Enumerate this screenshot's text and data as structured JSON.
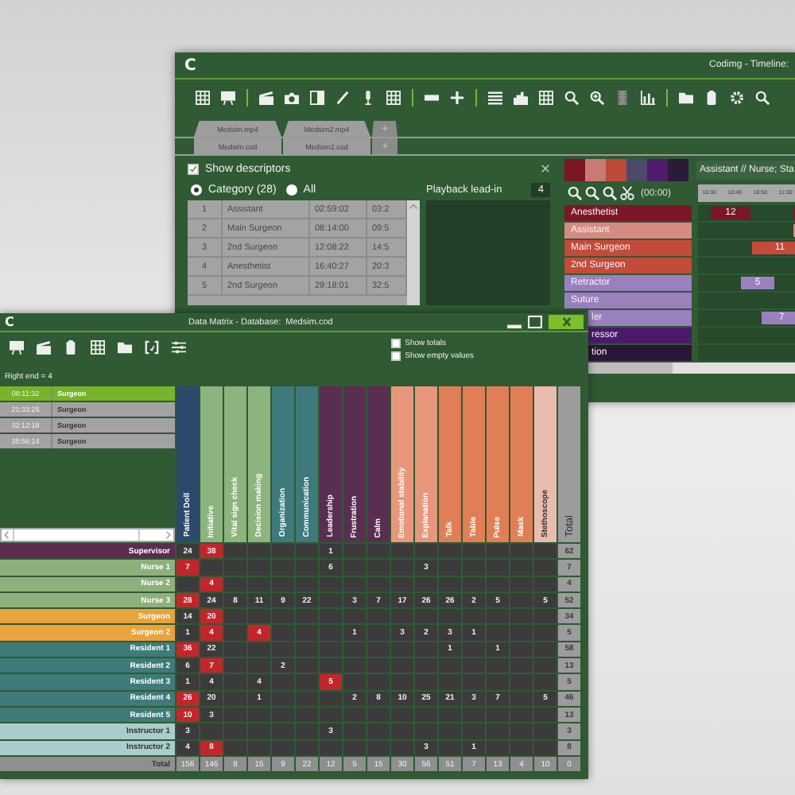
{
  "timeline_window": {
    "logo": "C",
    "title": "Codimg - Timeline:",
    "media_tabs": [
      {
        "label": "Medsim.mp4",
        "kind": "file"
      },
      {
        "label": "Medsim2.mp4",
        "kind": "file"
      },
      {
        "label": "+",
        "kind": "add"
      }
    ],
    "file_tabs": [
      {
        "label": "Medsim.cod",
        "kind": "file"
      },
      {
        "label": "Medsim2.cod",
        "kind": "file"
      },
      {
        "label": "+",
        "kind": "add"
      }
    ],
    "show_descriptors": {
      "label": "Show descriptors",
      "checked": true
    },
    "filters": [
      {
        "label": "Category (28)",
        "selected": true
      },
      {
        "label": "All",
        "selected": false
      }
    ],
    "descriptors": [
      {
        "number": "1",
        "name": "Assistant",
        "start": "02:59:02",
        "end": "03:2"
      },
      {
        "number": "2",
        "name": "Main Surgeon",
        "start": "08:14:00",
        "end": "09:5"
      },
      {
        "number": "3",
        "name": "2nd Surgeon",
        "start": "12:08:22",
        "end": "14:5"
      },
      {
        "number": "4",
        "name": "Anesthetist",
        "start": "16:40:27",
        "end": "20:3"
      },
      {
        "number": "5",
        "name": "2nd Surgeon",
        "start": "29:18:01",
        "end": "32:5"
      }
    ],
    "playback_lead_in": {
      "label": "Playback lead-in",
      "value": "4"
    },
    "swatches": [
      {
        "color": "#7a1626"
      },
      {
        "color": "#c97b73"
      },
      {
        "color": "#bd4a3b"
      },
      {
        "color": "#4c4a6a"
      },
      {
        "color": "#4d1d6c"
      },
      {
        "color": "#2c1a3a"
      }
    ],
    "selection": "Assistant // Nurse; Sta",
    "time_display": "(00:00)",
    "ruler": [
      "10:30",
      "10:40",
      "10:50",
      "11:00"
    ],
    "tracks": [
      {
        "label": "Anesthetist",
        "color": "#7d1628",
        "clipped": false,
        "bars": [
          {
            "kind": "bar",
            "label": "12"
          },
          {
            "kind": "bar"
          }
        ]
      },
      {
        "label": "Assistant",
        "color": "#d68a84",
        "clipped": false,
        "bars": [
          {
            "kind": "bar"
          }
        ]
      },
      {
        "label": "Main Surgeon",
        "color": "#c44a3a",
        "clipped": false,
        "bars": [
          {
            "kind": "bar",
            "label": "11"
          }
        ]
      },
      {
        "label": "2nd Surgeon",
        "color": "#c44a3a",
        "clipped": false
      },
      {
        "label": "Retractor",
        "color": "#9a80bf",
        "clipped": false,
        "bars": [
          {
            "kind": "bar",
            "label": "5"
          }
        ]
      },
      {
        "label": "Suture",
        "color": "#9a80bf",
        "clipped": false
      },
      {
        "label": "ler",
        "color": "#9a80bf",
        "clipped": true,
        "bars": [
          {
            "kind": "bar",
            "label": "7"
          }
        ]
      },
      {
        "label": "ressor",
        "color": "#4b1a6a",
        "clipped": true
      },
      {
        "label": "tion",
        "color": "#2c1636",
        "clipped": true
      }
    ]
  },
  "matrix_window": {
    "logo": "C",
    "title": "Data Matrix - Database:  Medsim.cod",
    "options": [
      {
        "label": "Show totals",
        "checked": false
      },
      {
        "label": "Show empty values",
        "checked": false
      }
    ],
    "range": "Right end = 4",
    "events": [
      {
        "time": "08:11:32",
        "role": "Surgeon",
        "selected": true
      },
      {
        "time": "21:33:25",
        "role": "Surgeon",
        "selected": false
      },
      {
        "time": "32:12:18",
        "role": "Surgeon",
        "selected": false
      },
      {
        "time": "35:56:14",
        "role": "Surgeon",
        "selected": false
      }
    ],
    "columns": [
      {
        "label": "Patient Doll",
        "color": "#2b4a6c"
      },
      {
        "label": "Initiative",
        "color": "#8db37e"
      },
      {
        "label": "Vital sign check",
        "color": "#8db37e"
      },
      {
        "label": "Decision making",
        "color": "#8db37e"
      },
      {
        "label": "Organization",
        "color": "#3e7a7c"
      },
      {
        "label": "Communication",
        "color": "#3e7a7c"
      },
      {
        "label": "Leadership",
        "color": "#5a2e50"
      },
      {
        "label": "Frustration",
        "color": "#5a2e50"
      },
      {
        "label": "Calm",
        "color": "#5a2e50"
      },
      {
        "label": "Emotional stability",
        "color": "#e8977c"
      },
      {
        "label": "Explanation",
        "color": "#e8977c"
      },
      {
        "label": "Talk",
        "color": "#e07f55"
      },
      {
        "label": "Table",
        "color": "#e07f55"
      },
      {
        "label": "Pulse",
        "color": "#e07f55"
      },
      {
        "label": "Mask",
        "color": "#e07f55"
      },
      {
        "label": "Stethoscope",
        "color": "#eabcae"
      }
    ],
    "total_column": "Total",
    "rows": [
      {
        "label": "Supervisor",
        "color": "#5b2c4f",
        "total": "62",
        "cells": [
          {
            "value": "24",
            "flagged": false
          },
          {
            "value": "38",
            "flagged": true
          },
          {
            "flagged": false
          },
          {
            "flagged": false
          },
          {
            "flagged": false
          },
          {
            "flagged": false
          },
          {
            "value": "1",
            "flagged": false
          },
          {
            "flagged": false
          },
          {
            "flagged": false
          },
          {
            "flagged": false
          },
          {
            "flagged": false
          },
          {
            "flagged": false
          },
          {
            "flagged": false
          },
          {
            "flagged": false
          },
          {
            "flagged": false
          },
          {
            "flagged": false
          }
        ]
      },
      {
        "label": "Nurse 1",
        "color": "#8fb07c",
        "total": "7",
        "cells": [
          {
            "value": "7",
            "flagged": true
          },
          {
            "flagged": false
          },
          {
            "flagged": false
          },
          {
            "flagged": false
          },
          {
            "flagged": false
          },
          {
            "flagged": false
          },
          {
            "value": "6",
            "flagged": false
          },
          {
            "flagged": false
          },
          {
            "flagged": false
          },
          {
            "flagged": false
          },
          {
            "value": "3",
            "flagged": false
          },
          {
            "flagged": false
          },
          {
            "flagged": false
          },
          {
            "flagged": false
          },
          {
            "flagged": false
          },
          {
            "flagged": false
          }
        ]
      },
      {
        "label": "Nurse 2",
        "color": "#8fb07c",
        "total": "4",
        "cells": [
          {
            "flagged": false
          },
          {
            "value": "4",
            "flagged": true
          },
          {
            "flagged": false
          },
          {
            "flagged": false
          },
          {
            "flagged": false
          },
          {
            "flagged": false
          },
          {
            "flagged": false
          },
          {
            "flagged": false
          },
          {
            "flagged": false
          },
          {
            "flagged": false
          },
          {
            "flagged": false
          },
          {
            "flagged": false
          },
          {
            "flagged": false
          },
          {
            "flagged": false
          },
          {
            "flagged": false
          },
          {
            "flagged": false
          }
        ]
      },
      {
        "label": "Nurse 3",
        "color": "#8fb07c",
        "total": "52",
        "cells": [
          {
            "value": "28",
            "flagged": true
          },
          {
            "value": "24",
            "flagged": false
          },
          {
            "value": "8",
            "flagged": false
          },
          {
            "value": "11",
            "flagged": false
          },
          {
            "value": "9",
            "flagged": false
          },
          {
            "value": "22",
            "flagged": false
          },
          {
            "flagged": false
          },
          {
            "value": "3",
            "flagged": false
          },
          {
            "value": "7",
            "flagged": false
          },
          {
            "value": "17",
            "flagged": false
          },
          {
            "value": "26",
            "flagged": false
          },
          {
            "value": "26",
            "flagged": false
          },
          {
            "value": "2",
            "flagged": false
          },
          {
            "value": "5",
            "flagged": false
          },
          {
            "flagged": false
          },
          {
            "value": "5",
            "flagged": false
          }
        ]
      },
      {
        "label": "Surgeon",
        "color": "#e8a33c",
        "total": "34",
        "cells": [
          {
            "value": "14",
            "flagged": false
          },
          {
            "value": "20",
            "flagged": true
          },
          {
            "flagged": false
          },
          {
            "flagged": false
          },
          {
            "flagged": false
          },
          {
            "flagged": false
          },
          {
            "flagged": false
          },
          {
            "flagged": false
          },
          {
            "flagged": false
          },
          {
            "flagged": false
          },
          {
            "flagged": false
          },
          {
            "flagged": false
          },
          {
            "flagged": false
          },
          {
            "flagged": false
          },
          {
            "flagged": false
          },
          {
            "flagged": false
          }
        ]
      },
      {
        "label": "Surgeon 2",
        "color": "#e8a33c",
        "total": "5",
        "cells": [
          {
            "value": "1",
            "flagged": false
          },
          {
            "value": "4",
            "flagged": true
          },
          {
            "flagged": false
          },
          {
            "value": "4",
            "flagged": true
          },
          {
            "flagged": false
          },
          {
            "flagged": false
          },
          {
            "flagged": false
          },
          {
            "value": "1",
            "flagged": false
          },
          {
            "flagged": false
          },
          {
            "value": "3",
            "flagged": false
          },
          {
            "value": "2",
            "flagged": false
          },
          {
            "value": "3",
            "flagged": false
          },
          {
            "value": "1",
            "flagged": false
          },
          {
            "flagged": false
          },
          {
            "flagged": false
          },
          {
            "flagged": false
          }
        ]
      },
      {
        "label": "Resident 1",
        "color": "#3e7b79",
        "total": "58",
        "cells": [
          {
            "value": "36",
            "flagged": true
          },
          {
            "value": "22",
            "flagged": false
          },
          {
            "flagged": false
          },
          {
            "flagged": false
          },
          {
            "flagged": false
          },
          {
            "flagged": false
          },
          {
            "flagged": false
          },
          {
            "flagged": false
          },
          {
            "flagged": false
          },
          {
            "flagged": false
          },
          {
            "flagged": false
          },
          {
            "value": "1",
            "flagged": false
          },
          {
            "flagged": false
          },
          {
            "value": "1",
            "flagged": false
          },
          {
            "flagged": false
          },
          {
            "flagged": false
          }
        ]
      },
      {
        "label": "Resident 2",
        "color": "#3e7b79",
        "total": "13",
        "cells": [
          {
            "value": "6",
            "flagged": false
          },
          {
            "value": "7",
            "flagged": true
          },
          {
            "flagged": false
          },
          {
            "flagged": false
          },
          {
            "value": "2",
            "flagged": false
          },
          {
            "flagged": false
          },
          {
            "flagged": false
          },
          {
            "flagged": false
          },
          {
            "flagged": false
          },
          {
            "flagged": false
          },
          {
            "flagged": false
          },
          {
            "flagged": false
          },
          {
            "flagged": false
          },
          {
            "flagged": false
          },
          {
            "flagged": false
          },
          {
            "flagged": false
          }
        ]
      },
      {
        "label": "Resident 3",
        "color": "#3e7b79",
        "total": "5",
        "cells": [
          {
            "value": "1",
            "flagged": false
          },
          {
            "value": "4",
            "flagged": false
          },
          {
            "flagged": false
          },
          {
            "value": "4",
            "flagged": false
          },
          {
            "flagged": false
          },
          {
            "flagged": false
          },
          {
            "value": "5",
            "flagged": true
          },
          {
            "flagged": false
          },
          {
            "flagged": false
          },
          {
            "flagged": false
          },
          {
            "flagged": false
          },
          {
            "flagged": false
          },
          {
            "flagged": false
          },
          {
            "flagged": false
          },
          {
            "flagged": false
          },
          {
            "flagged": false
          }
        ]
      },
      {
        "label": "Resident 4",
        "color": "#3e7b79",
        "total": "46",
        "cells": [
          {
            "value": "26",
            "flagged": true
          },
          {
            "value": "20",
            "flagged": false
          },
          {
            "flagged": false
          },
          {
            "value": "1",
            "flagged": false
          },
          {
            "flagged": false
          },
          {
            "flagged": false
          },
          {
            "flagged": false
          },
          {
            "value": "2",
            "flagged": false
          },
          {
            "value": "8",
            "flagged": false
          },
          {
            "value": "10",
            "flagged": false
          },
          {
            "value": "25",
            "flagged": false
          },
          {
            "value": "21",
            "flagged": false
          },
          {
            "value": "3",
            "flagged": false
          },
          {
            "value": "7",
            "flagged": false
          },
          {
            "flagged": false
          },
          {
            "value": "5",
            "flagged": false
          }
        ]
      },
      {
        "label": "Resident 5",
        "color": "#3e7b79",
        "total": "13",
        "cells": [
          {
            "value": "10",
            "flagged": true
          },
          {
            "value": "3",
            "flagged": false
          },
          {
            "flagged": false
          },
          {
            "flagged": false
          },
          {
            "flagged": false
          },
          {
            "flagged": false
          },
          {
            "flagged": false
          },
          {
            "flagged": false
          },
          {
            "flagged": false
          },
          {
            "flagged": false
          },
          {
            "flagged": false
          },
          {
            "flagged": false
          },
          {
            "flagged": false
          },
          {
            "flagged": false
          },
          {
            "flagged": false
          },
          {
            "flagged": false
          }
        ]
      },
      {
        "label": "Instructor 1",
        "color": "#a8cdcc",
        "total": "3",
        "cells": [
          {
            "value": "3",
            "flagged": false
          },
          {
            "flagged": false
          },
          {
            "flagged": false
          },
          {
            "flagged": false
          },
          {
            "flagged": false
          },
          {
            "flagged": false
          },
          {
            "value": "3",
            "flagged": false
          },
          {
            "flagged": false
          },
          {
            "flagged": false
          },
          {
            "flagged": false
          },
          {
            "flagged": false
          },
          {
            "flagged": false
          },
          {
            "flagged": false
          },
          {
            "flagged": false
          },
          {
            "flagged": false
          },
          {
            "flagged": false
          }
        ]
      },
      {
        "label": "Instructor 2",
        "color": "#a8cdcc",
        "total": "8",
        "cells": [
          {
            "value": "4",
            "flagged": false
          },
          {
            "value": "8",
            "flagged": true
          },
          {
            "flagged": false
          },
          {
            "flagged": false
          },
          {
            "flagged": false
          },
          {
            "flagged": false
          },
          {
            "flagged": false
          },
          {
            "flagged": false
          },
          {
            "flagged": false
          },
          {
            "flagged": false
          },
          {
            "value": "3",
            "flagged": false
          },
          {
            "flagged": false
          },
          {
            "value": "1",
            "flagged": false
          },
          {
            "flagged": false
          },
          {
            "flagged": false
          },
          {
            "flagged": false
          }
        ]
      }
    ],
    "totals": {
      "label": "Total",
      "values": [
        "156",
        "146",
        "8",
        "15",
        "9",
        "22",
        "12",
        "5",
        "15",
        "30",
        "56",
        "51",
        "7",
        "13",
        "4",
        "10"
      ],
      "total": "0"
    }
  }
}
